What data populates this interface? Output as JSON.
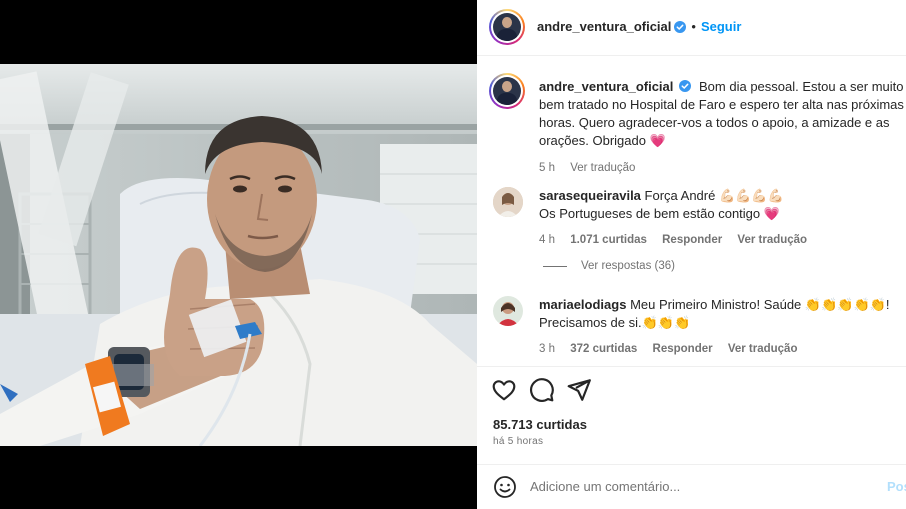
{
  "post": {
    "author": "andre_ventura_oficial",
    "follow_label": "Seguir",
    "dot": "•",
    "caption_text": "Bom dia pessoal. Estou a ser muito bem tratado no Hospital de Faro e espero ter alta nas próximas horas. Quero agradecer-vos a todos o apoio, a amizade e as orações. Obrigado",
    "caption_emoji": "💗",
    "caption_age": "5 h",
    "see_translation": "Ver tradução",
    "likes": "85.713 curtidas",
    "posted_ago": "há 5 horas"
  },
  "comments": [
    {
      "user": "sarasequeiravila",
      "text_line1": "Força André 💪🏻💪🏻💪🏻💪🏻",
      "text_line2": "Os Portugueses de bem estão contigo",
      "emoji_end": "💗",
      "age": "4 h",
      "likes": "1.071 curtidas",
      "reply": "Responder",
      "translate": "Ver tradução",
      "view_replies": "Ver respostas (36)"
    },
    {
      "user": "mariaelodiags",
      "text_line1": "Meu Primeiro Ministro! Saúde 👏👏👏👏👏!",
      "text_line2": "Precisamos de si.👏👏👏",
      "age": "3 h",
      "likes": "372 curtidas",
      "reply": "Responder",
      "translate": "Ver tradução"
    }
  ],
  "composer": {
    "placeholder": "Adicione um comentário...",
    "post_label": "Pos"
  },
  "icons": {
    "like": "heart-outline-icon",
    "comment": "speech-bubble-icon",
    "share": "paper-plane-icon",
    "emoji": "smiley-icon",
    "verified": "verified-badge-icon"
  },
  "colors": {
    "accent_blue": "#0095f6",
    "verified_blue": "#3897f0",
    "text_primary": "#262626",
    "text_secondary": "#737373",
    "heart_pink": "#ed4956"
  }
}
